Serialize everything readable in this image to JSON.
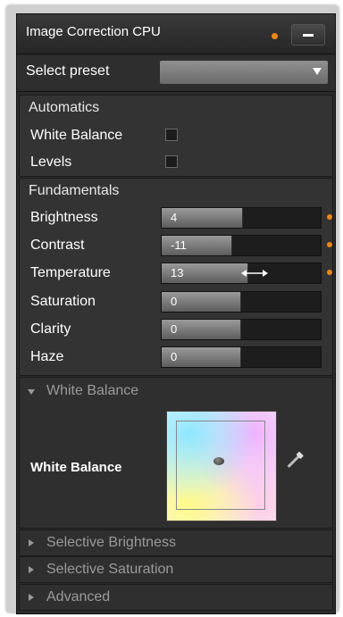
{
  "panel": {
    "title": "Image Correction CPU"
  },
  "preset": {
    "label": "Select preset",
    "value": ""
  },
  "automatics": {
    "title": "Automatics",
    "items": [
      {
        "label": "White Balance",
        "checked": false
      },
      {
        "label": "Levels",
        "checked": false
      }
    ]
  },
  "fundamentals": {
    "title": "Fundamentals",
    "sliders": [
      {
        "label": "Brightness",
        "value": "4",
        "modified": true
      },
      {
        "label": "Contrast",
        "value": "-11",
        "modified": true
      },
      {
        "label": "Temperature",
        "value": "13",
        "modified": true
      },
      {
        "label": "Saturation",
        "value": "0",
        "modified": false
      },
      {
        "label": "Clarity",
        "value": "0",
        "modified": false
      },
      {
        "label": "Haze",
        "value": "0",
        "modified": false
      }
    ]
  },
  "white_balance": {
    "title": "White Balance",
    "label": "White Balance"
  },
  "collapsed_sections": [
    {
      "label": "Selective Brightness"
    },
    {
      "label": "Selective Saturation"
    },
    {
      "label": "Advanced"
    }
  ],
  "colors": {
    "accent_dot": "#e8891a",
    "panel_bg": "#2b2b2b"
  }
}
